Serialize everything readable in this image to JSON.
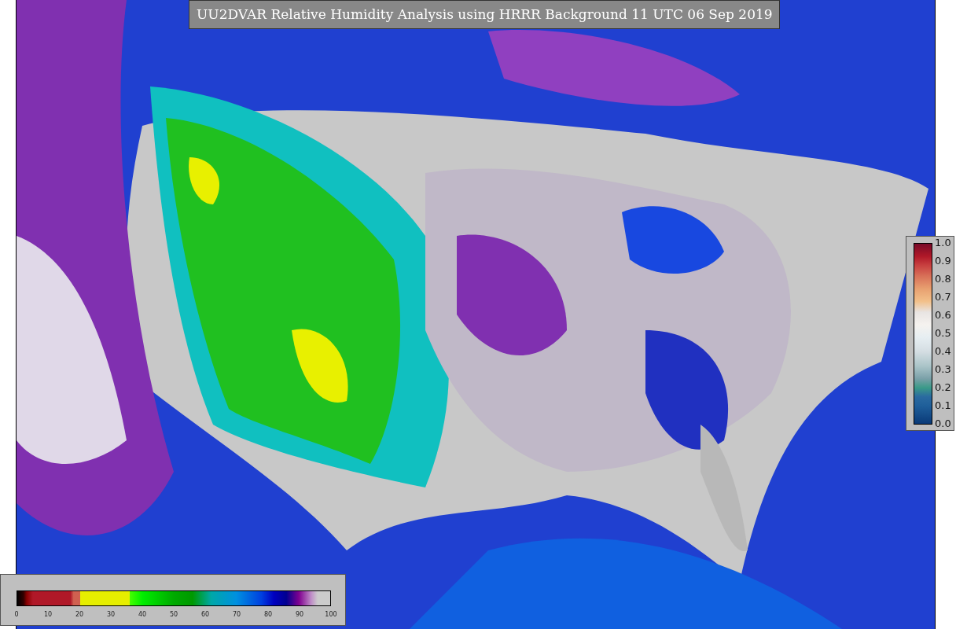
{
  "title": "UU2DVAR Relative Humidity Analysis using HRRR Background 11 UTC 06 Sep 2019",
  "observation_colorbar": {
    "ticks": [
      "1.0",
      "0.9",
      "0.8",
      "0.7",
      "0.6",
      "0.5",
      "0.4",
      "0.3",
      "0.2",
      "0.1",
      "0.0"
    ]
  },
  "humidity_colorbar": {
    "ticks": [
      "0",
      "10",
      "20",
      "30",
      "40",
      "50",
      "60",
      "70",
      "80",
      "90",
      "100"
    ]
  }
}
